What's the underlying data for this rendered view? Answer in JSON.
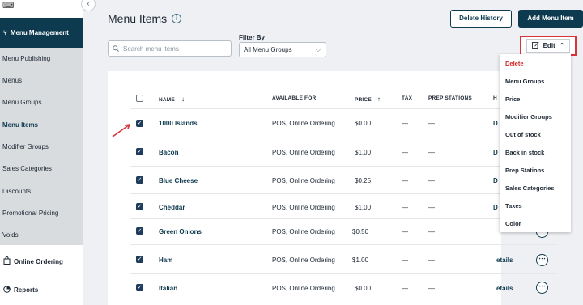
{
  "sidebar": {
    "header_label": "Menu Management",
    "items": [
      {
        "label": "Menu Publishing"
      },
      {
        "label": "Menus"
      },
      {
        "label": "Menu Groups"
      },
      {
        "label": "Menu Items",
        "active": true
      },
      {
        "label": "Modifier Groups"
      },
      {
        "label": "Sales Categories"
      },
      {
        "label": "Discounts"
      },
      {
        "label": "Promotional Pricing"
      },
      {
        "label": "Voids"
      }
    ],
    "online_ordering": "Online Ordering",
    "reports": "Reports"
  },
  "header": {
    "title": "Menu Items",
    "delete_history": "Delete History",
    "add_item": "Add Menu Item"
  },
  "filters": {
    "search_placeholder": "Search menu items",
    "filter_by_label": "Filter By",
    "filter_value": "All Menu Groups",
    "edit_label": "Edit"
  },
  "table": {
    "columns": [
      "NAME",
      "AVAILABLE FOR",
      "PRICE",
      "TAX",
      "PREP STATIONS",
      "H"
    ],
    "rows": [
      {
        "name": "1000 Islands",
        "available": "POS, Online Ordering",
        "price": "$0.00",
        "tax": "—",
        "prep": "—",
        "h": "D"
      },
      {
        "name": "Bacon",
        "available": "POS, Online Ordering",
        "price": "$1.00",
        "tax": "—",
        "prep": "—",
        "h": "D"
      },
      {
        "name": "Blue Cheese",
        "available": "POS, Online Ordering",
        "price": "$0.25",
        "tax": "—",
        "prep": "—",
        "h": "D"
      },
      {
        "name": "Cheddar",
        "available": "POS, Online Ordering",
        "price": "$1.00",
        "tax": "—",
        "prep": "—",
        "h": "D"
      },
      {
        "name": "Green Onions",
        "available": "POS, Online Ordering",
        "price": "$0.50",
        "tax": "—",
        "prep": "—",
        "h": ""
      },
      {
        "name": "Ham",
        "available": "POS, Online Ordering",
        "price": "$1.00",
        "tax": "—",
        "prep": "—",
        "h": "etails"
      },
      {
        "name": "Italian",
        "available": "POS, Online Ordering",
        "price": "$0.00",
        "tax": "—",
        "prep": "—",
        "h": "etails"
      }
    ]
  },
  "edit_menu": {
    "options": [
      "Delete",
      "Menu Groups",
      "Price",
      "Modifier Groups",
      "Out of stock",
      "Back in stock",
      "Prep Stations",
      "Sales Categories",
      "Taxes",
      "Color"
    ]
  },
  "colors": {
    "brand": "#0e3a4f",
    "highlight": "#d9333a",
    "danger": "#d12b2b"
  }
}
